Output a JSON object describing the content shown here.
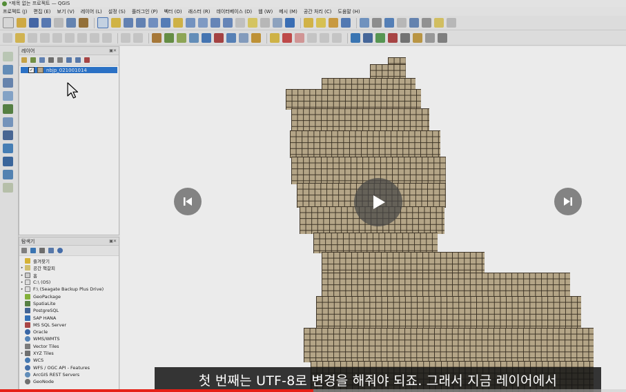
{
  "window": {
    "title": "*제목 없는 프로젝트 — QGIS"
  },
  "menu": [
    "프로젝트 (J)",
    "편집 (E)",
    "보기 (V)",
    "레이어 (L)",
    "설정 (S)",
    "플러그인 (P)",
    "벡터 (O)",
    "래스터 (R)",
    "데이터베이스 (D)",
    "웹 (W)",
    "메시 (M)",
    "공간 처리 (C)",
    "도움말 (H)"
  ],
  "layers_panel": {
    "title": "레이어",
    "layers": [
      {
        "name": "nbjp_021001014",
        "checked": true,
        "selected": true
      }
    ]
  },
  "browser_panel": {
    "title": "탐색기",
    "items": [
      {
        "label": "즐겨찾기",
        "icon": "star-icon"
      },
      {
        "label": "공간 책갈피",
        "icon": "bookmark-icon"
      },
      {
        "label": "홈",
        "icon": "home-folder-icon"
      },
      {
        "label": "C:\\ (OS)",
        "icon": "drive-icon"
      },
      {
        "label": "F:\\ (Seagate Backup Plus Drive)",
        "icon": "drive-icon"
      },
      {
        "label": "GeoPackage",
        "icon": "geopackage-icon"
      },
      {
        "label": "SpatiaLite",
        "icon": "spatialite-icon"
      },
      {
        "label": "PostgreSQL",
        "icon": "postgresql-icon"
      },
      {
        "label": "SAP HANA",
        "icon": "sap-hana-icon"
      },
      {
        "label": "MS SQL Server",
        "icon": "mssql-icon"
      },
      {
        "label": "Oracle",
        "icon": "oracle-icon"
      },
      {
        "label": "WMS/WMTS",
        "icon": "wms-icon"
      },
      {
        "label": "Vector Tiles",
        "icon": "vector-tiles-icon"
      },
      {
        "label": "XYZ Tiles",
        "icon": "xyz-tiles-icon"
      },
      {
        "label": "WCS",
        "icon": "wcs-icon"
      },
      {
        "label": "WFS / OGC API - Features",
        "icon": "wfs-icon"
      },
      {
        "label": "ArcGIS REST Servers",
        "icon": "arcgis-icon"
      },
      {
        "label": "GeoNode",
        "icon": "geonode-icon"
      }
    ]
  },
  "video": {
    "subtitle": "첫 번째는 UTF-8로 변경을 해줘야 되죠. 그래서 지금 레이어에서",
    "progress": 0.5
  },
  "colors": {
    "grid_fill": "#c4b493",
    "grid_line": "#3e3526",
    "selection": "#2f7bd6",
    "progress": "#e62117"
  }
}
